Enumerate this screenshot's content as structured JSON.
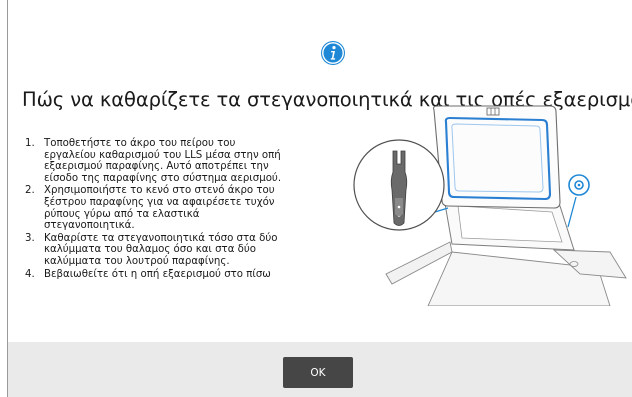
{
  "dialog": {
    "icon": "info-icon",
    "title": "Πώς να καθαρίζετε τα στεγανοποιητικά και τις οπές εξαερισμού",
    "steps": [
      {
        "number": "1.",
        "lines": [
          "Τοποθετήστε το άκρο του πείρου του",
          "εργαλείου καθαρισμού του LLS μέσα στην οπή",
          "εξαερισμού παραφίνης. Αυτό αποτρέπει την",
          "είσοδο της παραφίνης στο σύστημα αερισμού."
        ]
      },
      {
        "number": "2.",
        "lines": [
          "Χρησιμοποιήστε το κενό στο στενό άκρο του",
          "ξέστρου παραφίνης για να αφαιρέσετε τυχόν",
          "ρύπους γύρω από τα ελαστικά",
          "στεγανοποιητικά."
        ]
      },
      {
        "number": "3.",
        "lines": [
          "Καθαρίστε τα στεγανοποιητικά τόσο στα δύο",
          "καλύμματα του θαλαμος όσο και στα δύο",
          "καλύμματα του λουτρού παραφίνης."
        ]
      },
      {
        "number": "4.",
        "lines": [
          "Βεβαιωθείτε ότι η οπή εξαερισμού στο πίσω"
        ]
      }
    ],
    "ok_label": "OK"
  },
  "colors": {
    "accent": "#1e88d6",
    "button": "#464646",
    "footer": "#eaeaea"
  }
}
